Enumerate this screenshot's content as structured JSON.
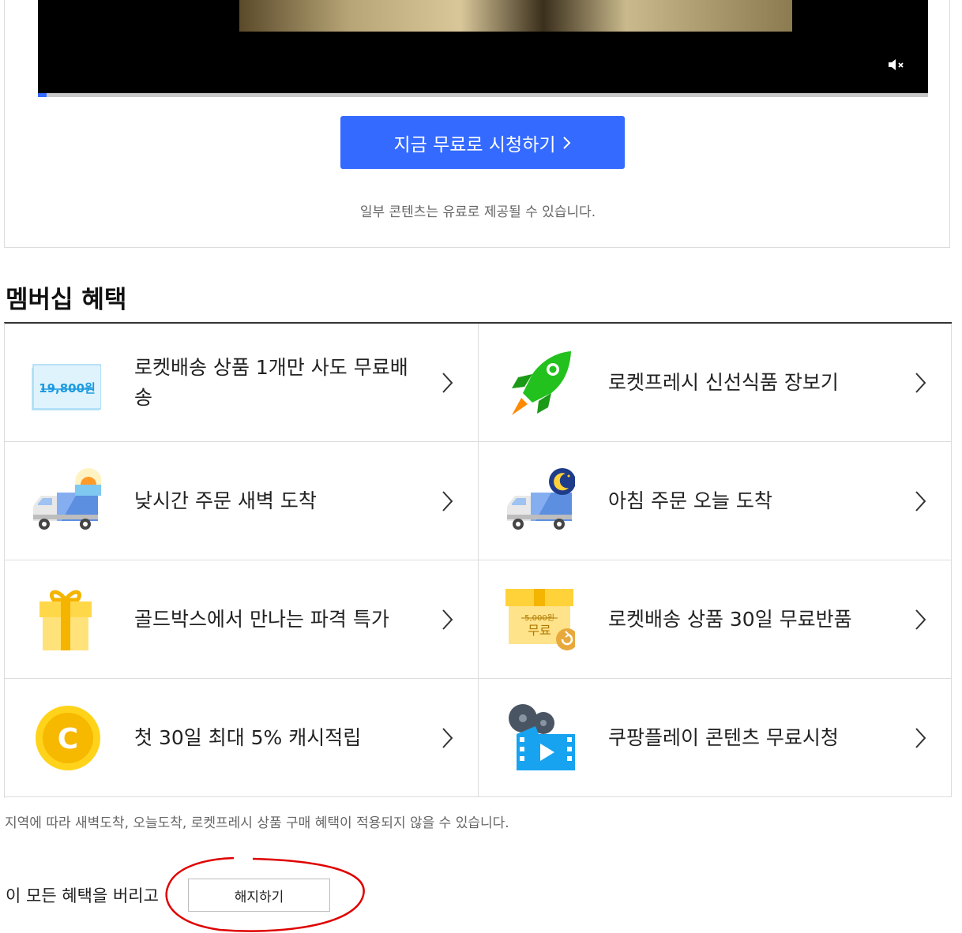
{
  "video": {
    "watch_label": "지금 무료로 시청하기",
    "note": "일부 콘텐츠는 유료로 제공될 수 있습니다.",
    "progress_percent": 1,
    "mute_icon": "speaker-muted-icon"
  },
  "benefits": {
    "title": "멤버십 혜택",
    "items": [
      {
        "label": "로켓배송 상품 1개만 사도 무료배송",
        "icon": "free-shipping-coupon-icon",
        "coupon_text": "19,800원"
      },
      {
        "label": "로켓프레시 신선식품 장보기",
        "icon": "rocket-icon"
      },
      {
        "label": "낮시간 주문 새벽 도착",
        "icon": "dawn-delivery-truck-icon"
      },
      {
        "label": "아침 주문 오늘 도착",
        "icon": "night-delivery-truck-icon"
      },
      {
        "label": "골드박스에서 만나는 파격 특가",
        "icon": "gift-box-icon"
      },
      {
        "label": "로켓배송 상품 30일 무료반품",
        "icon": "free-return-box-icon",
        "box_price": "5,000원",
        "box_text": "무료"
      },
      {
        "label": "첫 30일 최대 5% 캐시적립",
        "icon": "cash-coin-icon",
        "coin_text": "C"
      },
      {
        "label": "쿠팡플레이 콘텐츠 무료시청",
        "icon": "film-play-icon"
      }
    ],
    "region_note": "지역에 따라 새벽도착, 오늘도착, 로켓프레시 상품 구매 혜택이 적용되지 않을 수 있습니다."
  },
  "cancel": {
    "text": "이 모든 혜택을 버리고",
    "button_label": "해지하기"
  },
  "colors": {
    "accent": "#346aff",
    "annotation": "#e00000"
  }
}
